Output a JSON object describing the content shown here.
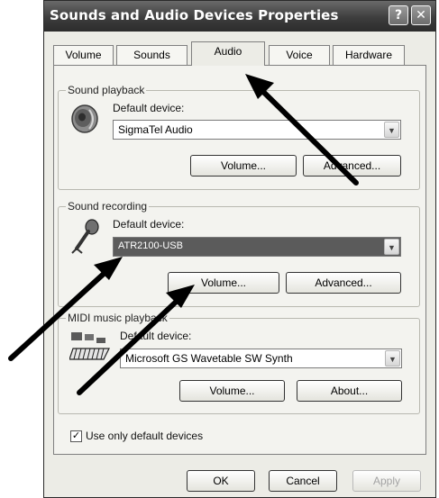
{
  "window": {
    "title": "Sounds and Audio Devices Properties",
    "help_glyph": "?",
    "close_glyph": "✕"
  },
  "tabs": [
    {
      "label": "Volume"
    },
    {
      "label": "Sounds"
    },
    {
      "label": "Audio",
      "active": true
    },
    {
      "label": "Voice"
    },
    {
      "label": "Hardware"
    }
  ],
  "sound_playback": {
    "group_label": "Sound playback",
    "device_label": "Default device:",
    "device_value": "SigmaTel Audio",
    "volume_button": "Volume...",
    "advanced_button": "Advanced..."
  },
  "sound_recording": {
    "group_label": "Sound recording",
    "device_label": "Default device:",
    "device_value": "ATR2100-USB",
    "volume_button": "Volume...",
    "advanced_button": "Advanced..."
  },
  "midi_playback": {
    "group_label": "MIDI music playback",
    "device_label": "Default device:",
    "device_value": "Microsoft GS Wavetable SW Synth",
    "volume_button": "Volume...",
    "about_button": "About..."
  },
  "use_default_devices": {
    "label": "Use only default devices",
    "checked": true
  },
  "dialog_buttons": {
    "ok": "OK",
    "cancel": "Cancel",
    "apply": "Apply"
  },
  "dropdown_glyph": "▼",
  "check_glyph": "✓",
  "icons": {
    "speaker": "speaker-icon",
    "microphone": "microphone-icon",
    "midi": "midi-keyboard-icon",
    "annotation": "arrow"
  },
  "colors": {
    "title_bar": "#3d3d3d",
    "dialog_bg": "#ecece6",
    "selected_field": "#5b5b5b"
  }
}
